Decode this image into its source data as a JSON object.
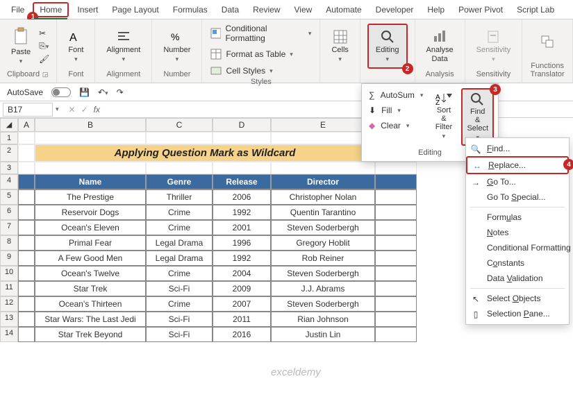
{
  "tabs": [
    "File",
    "Home",
    "Insert",
    "Page Layout",
    "Formulas",
    "Data",
    "Review",
    "View",
    "Automate",
    "Developer",
    "Help",
    "Power Pivot",
    "Script Lab"
  ],
  "activeTab": "Home",
  "ribbon": {
    "clipboard": {
      "paste": "Paste",
      "label": "Clipboard"
    },
    "font": {
      "btn": "Font",
      "label": "Font"
    },
    "alignment": {
      "btn": "Alignment",
      "label": "Alignment"
    },
    "number": {
      "btn": "Number",
      "label": "Number"
    },
    "styles": {
      "cond": "Conditional Formatting",
      "table": "Format as Table",
      "cell": "Cell Styles",
      "label": "Styles"
    },
    "cells": {
      "btn": "Cells"
    },
    "editing": {
      "btn": "Editing"
    },
    "analysis": {
      "btn": "Analyse Data",
      "label": "Analysis"
    },
    "sensitivity": {
      "btn": "Sensitivity",
      "label": "Sensitivity"
    },
    "functions": {
      "label": "Functions Translator"
    }
  },
  "qat": {
    "autosave": "AutoSave"
  },
  "namebox": "B17",
  "editingDrop": {
    "autosum": "AutoSum",
    "fill": "Fill",
    "clear": "Clear",
    "sort": "Sort & Filter",
    "find": "Find & Select",
    "label": "Editing"
  },
  "contextMenu": {
    "find": "Find...",
    "replace": "Replace...",
    "goto": "Go To...",
    "gotospecial": "Go To Special...",
    "formulas": "Formulas",
    "notes": "Notes",
    "condfmt": "Conditional Formatting",
    "constants": "Constants",
    "datavalidation": "Data Validation",
    "selectobjects": "Select Objects",
    "selectionpane": "Selection Pane..."
  },
  "sheet": {
    "title": "Applying Question Mark as Wildcard",
    "headers": [
      "Name",
      "Genre",
      "Release",
      "Director"
    ],
    "rows": [
      [
        "The Prestige",
        "Thriller",
        "2006",
        "Christopher Nolan"
      ],
      [
        "Reservoir Dogs",
        "Crime",
        "1992",
        "Quentin Tarantino"
      ],
      [
        "Ocean's Eleven",
        "Crime",
        "2001",
        "Steven Soderbergh"
      ],
      [
        "Primal Fear",
        "Legal Drama",
        "1996",
        "Gregory Hoblit"
      ],
      [
        "A Few Good Men",
        "Legal Drama",
        "1992",
        "Rob Reiner"
      ],
      [
        "Ocean's Twelve",
        "Crime",
        "2004",
        "Steven Soderbergh"
      ],
      [
        "Star Trek",
        "Sci-Fi",
        "2009",
        "J.J. Abrams"
      ],
      [
        "Ocean's Thirteen",
        "Crime",
        "2007",
        "Steven Soderbergh"
      ],
      [
        "Star Wars: The Last Jedi",
        "Sci-Fi",
        "2011",
        "Rian Johnson"
      ],
      [
        "Star Trek Beyond",
        "Sci-Fi",
        "2016",
        "Justin Lin"
      ]
    ]
  },
  "badges": {
    "b1": "1",
    "b2": "2",
    "b3": "3",
    "b4": "4"
  },
  "watermark": "exceldemy"
}
